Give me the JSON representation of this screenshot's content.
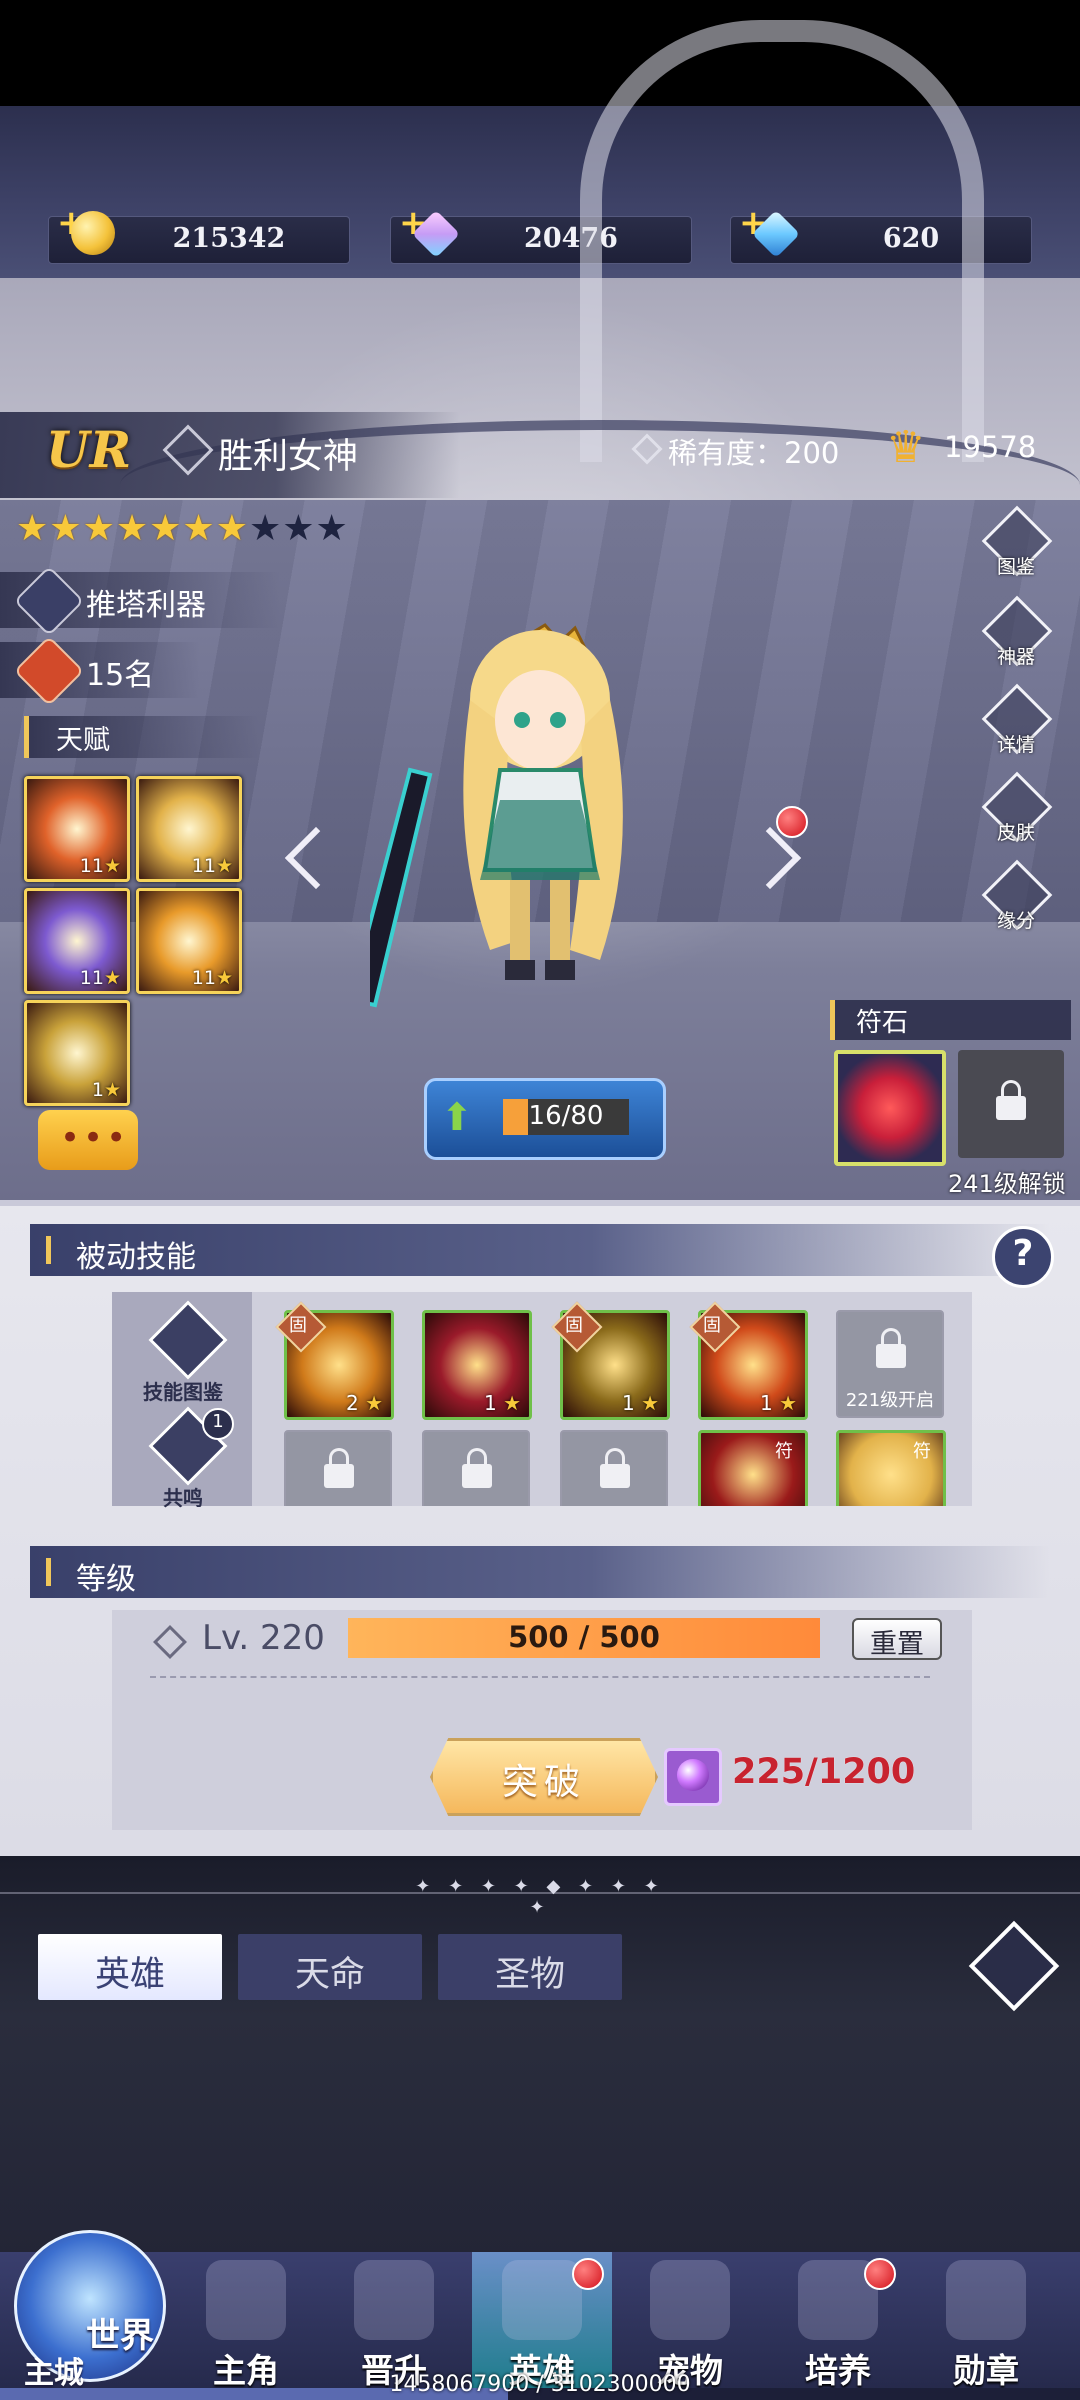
{
  "currency": [
    {
      "icon": "gold-coin-icon",
      "value": "215342",
      "color": "#f4c23a"
    },
    {
      "icon": "rainbow-gem-icon",
      "value": "20476",
      "color": "#c69cf5"
    },
    {
      "icon": "blue-diamond-icon",
      "value": "620",
      "color": "#6cc9ff"
    }
  ],
  "hero": {
    "grade": "UR",
    "name": "胜利女神",
    "rarity_label": "稀有度：200",
    "power": "19578",
    "stars_total": 10,
    "stars_filled": 7,
    "tag_role": "推塔利器",
    "tag_rank": "15名",
    "talent_title": "天赋",
    "talents": [
      {
        "level": "11",
        "color": "#e0622a"
      },
      {
        "level": "11",
        "color": "#e2b24a"
      },
      {
        "level": "11",
        "color": "#7d5ad0"
      },
      {
        "level": "11",
        "color": "#e89a2a"
      },
      {
        "level": "1",
        "color": "#c9a23a"
      }
    ],
    "level_text": "16/80",
    "level_fraction": 0.2
  },
  "side_buttons": [
    "图鉴",
    "神器",
    "详情",
    "皮肤",
    "缘分"
  ],
  "rune": {
    "title": "符石",
    "unlock_text": "241级解锁"
  },
  "chat_button": {
    "icon": "chat-bubble-icon",
    "label": "•••"
  },
  "passive": {
    "title": "被动技能",
    "help": "?",
    "left_buttons": [
      {
        "label": "技能图鉴",
        "icon": "skill-book-icon"
      },
      {
        "label": "共鸣",
        "icon": "resonance-icon",
        "badge": "1"
      }
    ],
    "skills_row1": [
      {
        "level": "2",
        "tag": "固",
        "color": "#d07a1a"
      },
      {
        "level": "1",
        "tag": "",
        "color": "#9a1a2a"
      },
      {
        "level": "1",
        "tag": "固",
        "color": "#8a6a1a"
      },
      {
        "level": "1",
        "tag": "固",
        "color": "#d04a1a"
      },
      {
        "locked": true,
        "unlock": "221级开启"
      }
    ],
    "skills_row2": [
      {
        "locked": true
      },
      {
        "locked": true
      },
      {
        "locked": true
      },
      {
        "level": "",
        "tag": "符",
        "color": "#9a1a1a"
      },
      {
        "level": "",
        "tag": "符",
        "color": "#e2b24a"
      }
    ]
  },
  "level_section": {
    "title": "等级",
    "level": "Lv. 220",
    "exp": "500 / 500",
    "reset": "重置",
    "break_button": "突破",
    "cost": "225/1200"
  },
  "tabs": [
    {
      "label": "英雄",
      "active": true
    },
    {
      "label": "天命",
      "active": false
    },
    {
      "label": "圣物",
      "active": false
    }
  ],
  "bottom_nav": {
    "world": "世界",
    "main_city": "主城",
    "items": [
      {
        "label": "主角",
        "icon": "protagonist-icon",
        "dot": false,
        "active": false
      },
      {
        "label": "晋升",
        "icon": "promote-icon",
        "dot": false,
        "active": false
      },
      {
        "label": "英雄",
        "icon": "hero-helmet-icon",
        "dot": true,
        "active": true
      },
      {
        "label": "宠物",
        "icon": "pet-icon",
        "dot": false,
        "active": false
      },
      {
        "label": "培养",
        "icon": "cultivate-icon",
        "dot": true,
        "active": false
      },
      {
        "label": "勋章",
        "icon": "medal-icon",
        "dot": false,
        "active": false
      }
    ],
    "progress_text": "1458067900 / 3102300000",
    "progress_fraction": 0.47
  }
}
